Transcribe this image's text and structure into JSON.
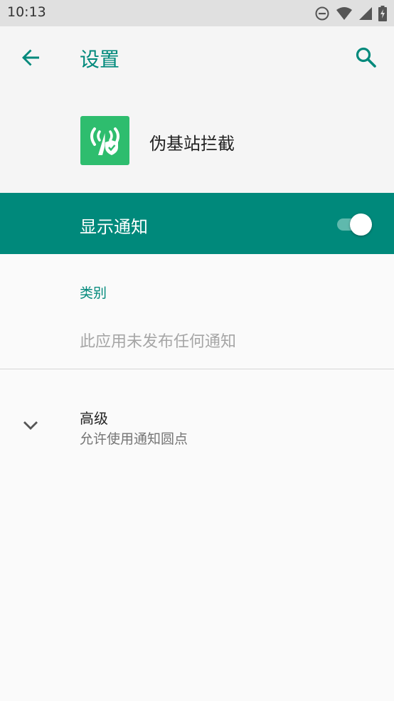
{
  "status_bar": {
    "time": "10:13",
    "icons": [
      "do-not-disturb-icon",
      "wifi-icon",
      "signal-icon",
      "battery-charging-icon"
    ]
  },
  "app_bar": {
    "title": "设置",
    "back_icon": "arrow-back-icon",
    "search_icon": "search-icon"
  },
  "app_info": {
    "name": "伪基站拦截",
    "icon": "app-icon"
  },
  "master_switch": {
    "label": "显示通知",
    "state": "on"
  },
  "categories": {
    "header": "类别",
    "empty_text": "此应用未发布任何通知"
  },
  "advanced": {
    "title": "高级",
    "summary": "允许使用通知圆点",
    "icon": "chevron-down-icon"
  },
  "colors": {
    "accent": "#00897b",
    "app_icon_bg": "#2ebd6e"
  }
}
